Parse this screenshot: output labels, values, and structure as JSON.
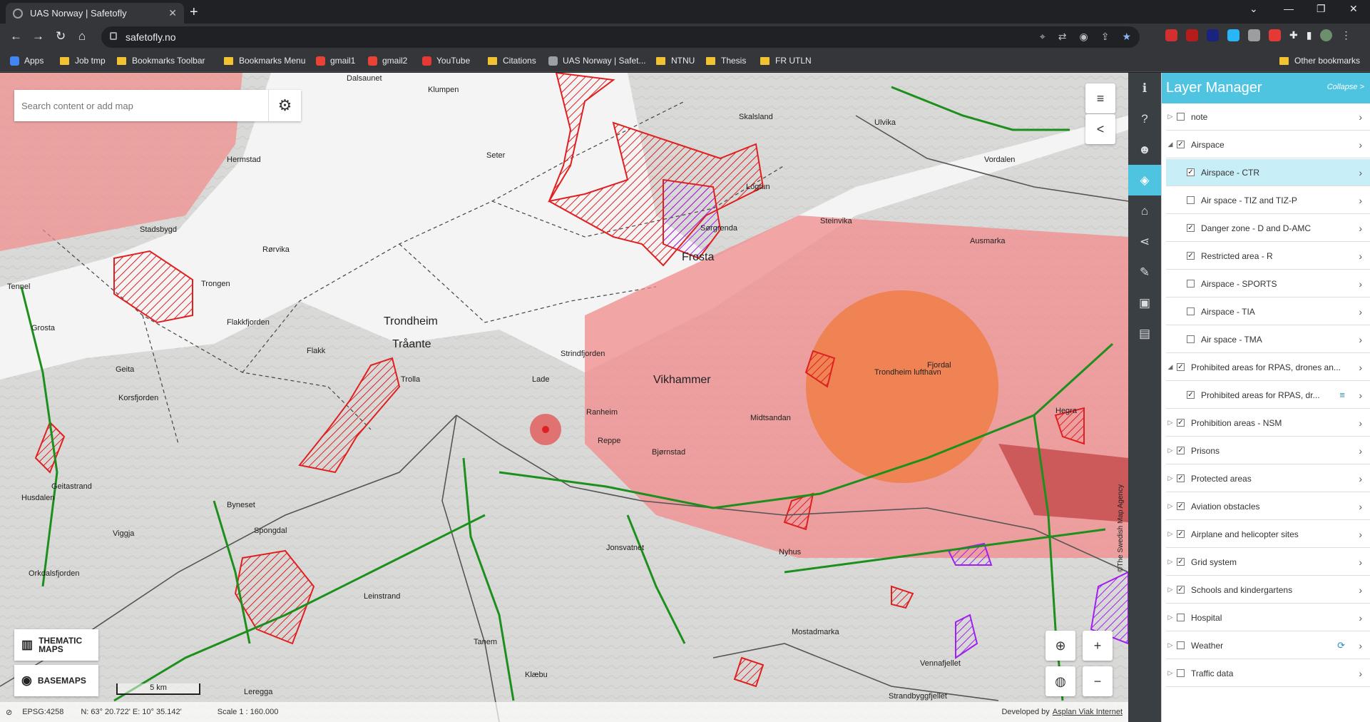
{
  "browser": {
    "tab_title": "UAS Norway | Safetofly",
    "url": "safetofly.no",
    "bookmarks": [
      {
        "label": "Apps",
        "type": "apps"
      },
      {
        "label": "Job tmp",
        "type": "folder"
      },
      {
        "label": "Bookmarks Toolbar",
        "type": "folder"
      },
      {
        "label": "Bookmarks Menu",
        "type": "folder"
      },
      {
        "label": "gmail1",
        "type": "gmail"
      },
      {
        "label": "gmail2",
        "type": "gmail"
      },
      {
        "label": "YouTube",
        "type": "youtube"
      },
      {
        "label": "Citations",
        "type": "folder"
      },
      {
        "label": "UAS Norway | Safet...",
        "type": "globe"
      },
      {
        "label": "NTNU",
        "type": "folder"
      },
      {
        "label": "Thesis",
        "type": "folder"
      },
      {
        "label": "FR UTLN",
        "type": "folder"
      }
    ],
    "other_bookmarks": "Other bookmarks"
  },
  "map": {
    "search_placeholder": "Search content or add map",
    "thematic_maps": "THEMATIC MAPS",
    "basemaps": "BASEMAPS",
    "scale_label": "5 km",
    "status": {
      "epsg": "EPSG:4258",
      "coords": "N: 63° 20.722'  E: 10° 35.142'",
      "scale": "Scale 1 : 160.000",
      "developed_by": "Developed by",
      "developer": "Asplan Viak Internet"
    },
    "attribution": "©The Swedish Map Agency",
    "places": [
      {
        "name": "Trondheim",
        "big": true
      },
      {
        "name": "Tråante",
        "big": true
      },
      {
        "name": "Frosta",
        "big": true
      },
      {
        "name": "Vikhammer",
        "big": true
      },
      {
        "name": "Seter"
      },
      {
        "name": "Dalsaunet"
      },
      {
        "name": "Klumpen"
      },
      {
        "name": "Hermstad"
      },
      {
        "name": "Stadsbygd"
      },
      {
        "name": "Rørvika"
      },
      {
        "name": "Trongen"
      },
      {
        "name": "Tennel"
      },
      {
        "name": "Grosta"
      },
      {
        "name": "Geita"
      },
      {
        "name": "Korsfjorden"
      },
      {
        "name": "Flakk"
      },
      {
        "name": "Trolla"
      },
      {
        "name": "Lade"
      },
      {
        "name": "Ranheim"
      },
      {
        "name": "Midtsandan"
      },
      {
        "name": "Reppe"
      },
      {
        "name": "Bjørnstad"
      },
      {
        "name": "Hegra"
      },
      {
        "name": "Steinvika"
      },
      {
        "name": "Sørgrenda"
      },
      {
        "name": "Logtun"
      },
      {
        "name": "Ulvika"
      },
      {
        "name": "Vordalen"
      },
      {
        "name": "Skalsland"
      },
      {
        "name": "Byneset"
      },
      {
        "name": "Spongdal"
      },
      {
        "name": "Viggja"
      },
      {
        "name": "Leinstrand"
      },
      {
        "name": "Tanem"
      },
      {
        "name": "Klæbu"
      },
      {
        "name": "Vennafjellet"
      },
      {
        "name": "Mostadmarka"
      },
      {
        "name": "Jonsvatnet"
      },
      {
        "name": "Nyhus"
      },
      {
        "name": "Strandbyggfjellet"
      },
      {
        "name": "Orkdalsfjorden"
      },
      {
        "name": "Husdalen"
      },
      {
        "name": "Geitastrand"
      },
      {
        "name": "Leregga"
      },
      {
        "name": "Ausmarka"
      },
      {
        "name": "Fjordal"
      },
      {
        "name": "Strindfjorden"
      },
      {
        "name": "Flakkfjorden"
      },
      {
        "name": "Trondheim lufthavn"
      }
    ]
  },
  "sidebar_icons": [
    "info-icon",
    "help-icon",
    "user-icon",
    "layers-icon",
    "tag-icon",
    "share-icon",
    "pencil-icon",
    "briefcase-icon",
    "bookmark-icon"
  ],
  "layer_manager": {
    "title": "Layer Manager",
    "collapse": "Collapse >",
    "layers": [
      {
        "label": "note",
        "checked": false,
        "expand": "collapsed",
        "indent": 0
      },
      {
        "label": "Airspace",
        "checked": true,
        "expand": "expanded",
        "indent": 0
      },
      {
        "label": "Airspace - CTR",
        "checked": true,
        "expand": "none",
        "indent": 1,
        "selected": true
      },
      {
        "label": "Air space - TIZ and TIZ-P",
        "checked": false,
        "expand": "none",
        "indent": 1
      },
      {
        "label": "Danger zone - D and D-AMC",
        "checked": true,
        "expand": "none",
        "indent": 1
      },
      {
        "label": "Restricted area - R",
        "checked": true,
        "expand": "none",
        "indent": 1
      },
      {
        "label": "Airspace - SPORTS",
        "checked": false,
        "expand": "none",
        "indent": 1
      },
      {
        "label": "Airspace - TIA",
        "checked": false,
        "expand": "none",
        "indent": 1
      },
      {
        "label": "Air space - TMA",
        "checked": false,
        "expand": "none",
        "indent": 1
      },
      {
        "label": "Prohibited areas for RPAS, drones an...",
        "checked": true,
        "expand": "expanded",
        "indent": 0
      },
      {
        "label": "Prohibited areas for RPAS, dr...",
        "checked": true,
        "expand": "none",
        "indent": 1,
        "extra": "≡"
      },
      {
        "label": "Prohibition areas - NSM",
        "checked": true,
        "expand": "collapsed",
        "indent": 0
      },
      {
        "label": "Prisons",
        "checked": true,
        "expand": "collapsed",
        "indent": 0
      },
      {
        "label": "Protected areas",
        "checked": true,
        "expand": "collapsed",
        "indent": 0
      },
      {
        "label": "Aviation obstacles",
        "checked": true,
        "expand": "collapsed",
        "indent": 0
      },
      {
        "label": "Airplane and helicopter sites",
        "checked": true,
        "expand": "collapsed",
        "indent": 0
      },
      {
        "label": "Grid system",
        "checked": true,
        "expand": "collapsed",
        "indent": 0
      },
      {
        "label": "Schools and kindergartens",
        "checked": true,
        "expand": "collapsed",
        "indent": 0
      },
      {
        "label": "Hospital",
        "checked": false,
        "expand": "collapsed",
        "indent": 0
      },
      {
        "label": "Weather",
        "checked": false,
        "expand": "collapsed",
        "indent": 0,
        "extra": "⟳"
      },
      {
        "label": "Traffic data",
        "checked": false,
        "expand": "collapsed",
        "indent": 0
      }
    ]
  },
  "colors": {
    "accent": "#4fc4e0",
    "ctr_fill": "#f28b8b",
    "restricted": "#e02020",
    "grid": "#22a822",
    "danger": "#a020f0"
  }
}
